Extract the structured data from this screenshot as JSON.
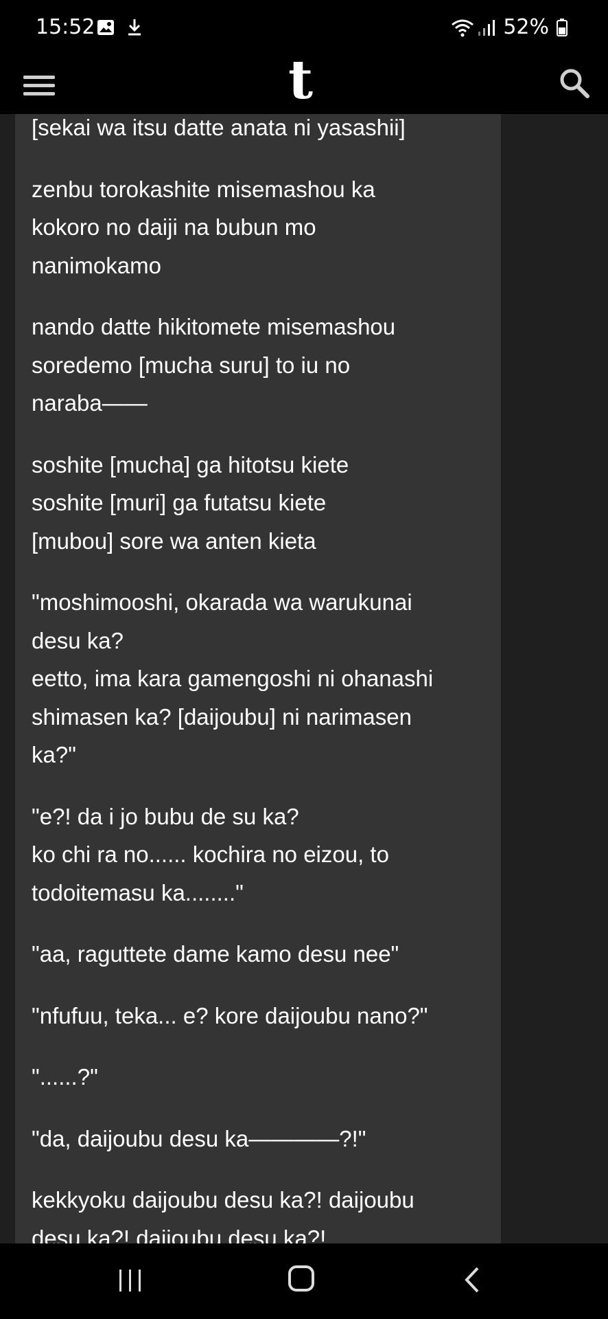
{
  "status_bar": {
    "time": "15:52",
    "battery": "52%",
    "left_icons": [
      "image-icon",
      "download-icon"
    ],
    "right_icons": [
      "wifi-icon",
      "signal-icon",
      "battery-icon"
    ]
  },
  "top_bar": {
    "logo": "t",
    "left_icon": "menu-icon",
    "right_icon": "search-icon"
  },
  "post": {
    "paragraphs": [
      [
        "[sekai wa itsu datte anata ni yasashii]"
      ],
      [
        "zenbu torokashite misemashou ka",
        "kokoro no daiji na bubun mo",
        "nanimokamo"
      ],
      [
        "nando datte hikitomete misemashou",
        "soredemo [mucha suru] to iu no",
        "naraba——"
      ],
      [
        "soshite [mucha] ga hitotsu kiete",
        "soshite [muri] ga futatsu kiete",
        "[mubou] sore wa anten kieta"
      ],
      [
        "\"moshimooshi, okarada wa warukunai",
        "desu ka?",
        "eetto, ima kara gamengoshi ni ohanashi",
        "shimasen ka? [daijoubu] ni narimasen",
        "ka?\""
      ],
      [
        "\"e?! da i jo bubu de su ka?",
        "ko chi ra no...... kochira no eizou, to",
        "todoitemasu ka........\""
      ],
      [
        "\"aa, raguttete dame kamo desu nee\""
      ],
      [
        "\"nfufuu, teka... e? kore daijoubu nano?\""
      ],
      [
        "\"......?\""
      ],
      [
        "\"da, daijoubu desu ka————?!\""
      ],
      [
        "kekkyoku daijoubu desu ka?! daijoubu",
        "desu ka?! daijoubu desu ka?!"
      ]
    ]
  },
  "nav_bar": {
    "buttons": [
      "recents-icon",
      "home-icon",
      "back-icon"
    ]
  },
  "colors": {
    "background": "#000000",
    "content_bg": "#1f1f1f",
    "card_bg": "#343434",
    "text": "#ffffff"
  }
}
